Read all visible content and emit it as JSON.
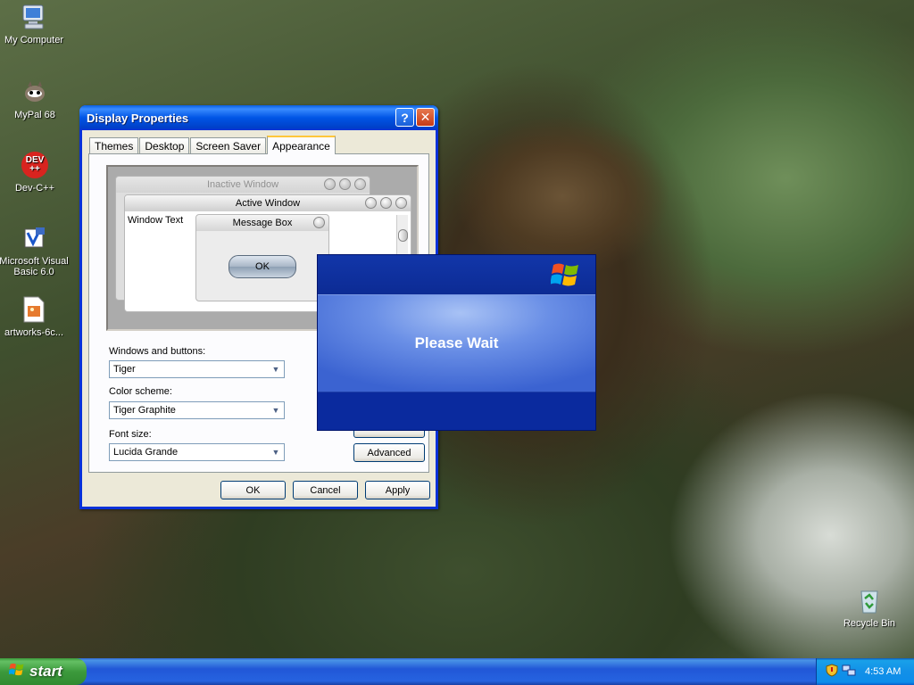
{
  "desktop": {
    "icons": [
      {
        "label": "My Computer",
        "icon": "my-computer-icon"
      },
      {
        "label": "MyPal 68",
        "icon": "mypal-icon"
      },
      {
        "label": "Dev-C++",
        "icon": "devcpp-icon",
        "badge": "DEV"
      },
      {
        "label": "Microsoft Visual Basic 6.0",
        "icon": "vb6-icon"
      },
      {
        "label": "artworks-6c...",
        "icon": "image-file-icon"
      },
      {
        "label": "Recycle Bin",
        "icon": "recycle-bin-icon"
      }
    ]
  },
  "display_properties": {
    "title": "Display Properties",
    "help_glyph": "?",
    "close_glyph": "✕",
    "tabs": [
      "Themes",
      "Desktop",
      "Screen Saver",
      "Appearance"
    ],
    "active_tab": "Appearance",
    "preview": {
      "inactive_title": "Inactive Window",
      "active_title": "Active Window",
      "window_text": "Window Text",
      "message_box_title": "Message Box",
      "ok_label": "OK"
    },
    "windows_and_buttons_label": "Windows and buttons:",
    "windows_and_buttons_value": "Tiger",
    "color_scheme_label": "Color scheme:",
    "color_scheme_value": "Tiger Graphite",
    "font_size_label": "Font size:",
    "font_size_value": "Lucida Grande",
    "advanced_label": "Advanced",
    "ok_label": "OK",
    "cancel_label": "Cancel",
    "apply_label": "Apply"
  },
  "please_wait": {
    "message": "Please Wait",
    "logo": "windows-flag-icon"
  },
  "taskbar": {
    "start_label": "start",
    "clock": "4:53 AM",
    "tray_icons": [
      "security-shield-icon",
      "network-icon"
    ]
  },
  "colors": {
    "title_blue": "#0055e5",
    "start_green": "#3c9a3c",
    "taskbar_blue": "#2157d7",
    "wait_blue": "#0a2a9e"
  }
}
